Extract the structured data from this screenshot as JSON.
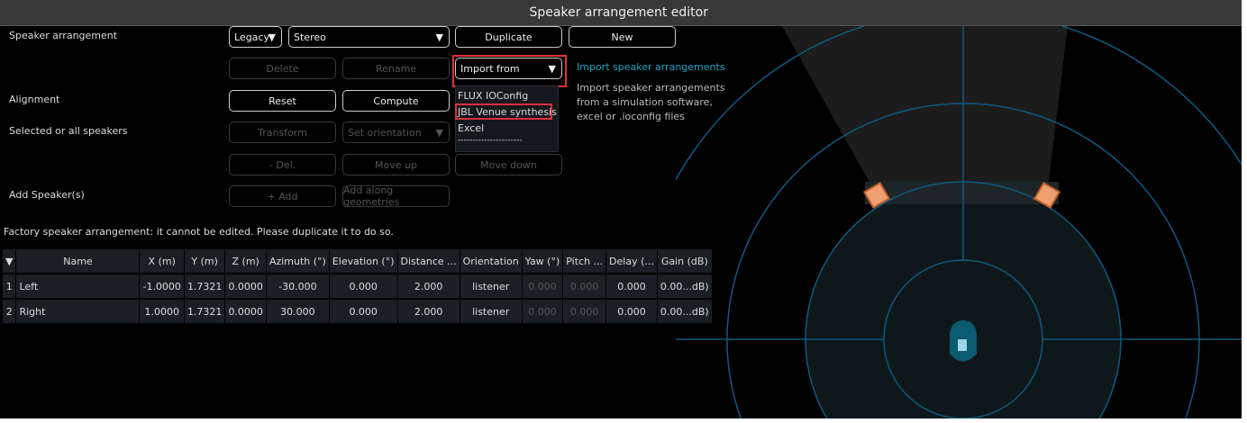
{
  "title": "Speaker arrangement editor",
  "labels": {
    "arrangement": "Speaker arrangement",
    "alignment": "Alignment",
    "selected": "Selected or all speakers",
    "add": "Add Speaker(s)"
  },
  "controls": {
    "legacy": "Legacy",
    "preset": "Stereo",
    "duplicate": "Duplicate",
    "new": "New",
    "delete": "Delete",
    "rename": "Rename",
    "import_from": "Import from",
    "reset": "Reset",
    "compute": "Compute",
    "transform": "Transform",
    "set_orientation": "Set orientation",
    "del": "- Del.",
    "move_up": "Move up",
    "move_down": "Move down",
    "add": "+ Add",
    "add_along": "Add along geometries"
  },
  "import_menu": [
    "FLUX IOConfig",
    "JBL Venue synthesis",
    "Excel",
    "----------------------"
  ],
  "info": {
    "title": "Import speaker arrangements",
    "text": "Import speaker arrangements from a simulation software, excel or .ioconfig files"
  },
  "note": "Factory speaker arrangement: it cannot be edited. Please duplicate it to do so.",
  "table": {
    "headers": [
      "▼",
      "Name",
      "X (m)",
      "Y (m)",
      "Z (m)",
      "Azimuth (°)",
      "Elevation (°)",
      "Distance ...",
      "Orientation",
      "Yaw (°)",
      "Pitch ...",
      "Delay (...",
      "Gain (dB)"
    ],
    "rows": [
      [
        "1",
        "Left",
        "-1.0000",
        "1.7321",
        "0.0000",
        "-30.000",
        "0.000",
        "2.000",
        "listener",
        "0.000",
        "0.000",
        "0.000",
        "0.00...dB)"
      ],
      [
        "2",
        "Right",
        "1.0000",
        "1.7321",
        "0.0000",
        "30.000",
        "0.000",
        "2.000",
        "listener",
        "0.000",
        "0.000",
        "0.000",
        "0.00...dB)"
      ]
    ]
  },
  "colors": {
    "accent": "#1aa6c8",
    "highlight": "#e0303a",
    "speaker": "#f0a070",
    "grid": "#0e5a80"
  }
}
